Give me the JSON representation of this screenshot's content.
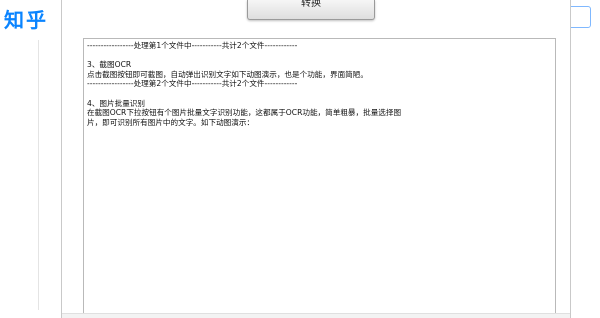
{
  "site": {
    "logo": "知乎"
  },
  "dialog": {
    "convert_button": "转换",
    "lines": [
      "-----------------处理第1个文件中-----------共计2个文件------------",
      "",
      "3、截图OCR",
      "点击截图按钮即可截图，自动弹出识别文字如下动图演示，也是个功能，界面简陋。",
      "-----------------处理第2个文件中-----------共计2个文件------------",
      "",
      "4、图片批量识别",
      "在截图OCR下拉按钮有个图片批量文字识别功能，这都属于OCR功能，简单粗暴，批量选择图",
      "片，即可识别所有图片中的文字。如下动图演示："
    ]
  }
}
